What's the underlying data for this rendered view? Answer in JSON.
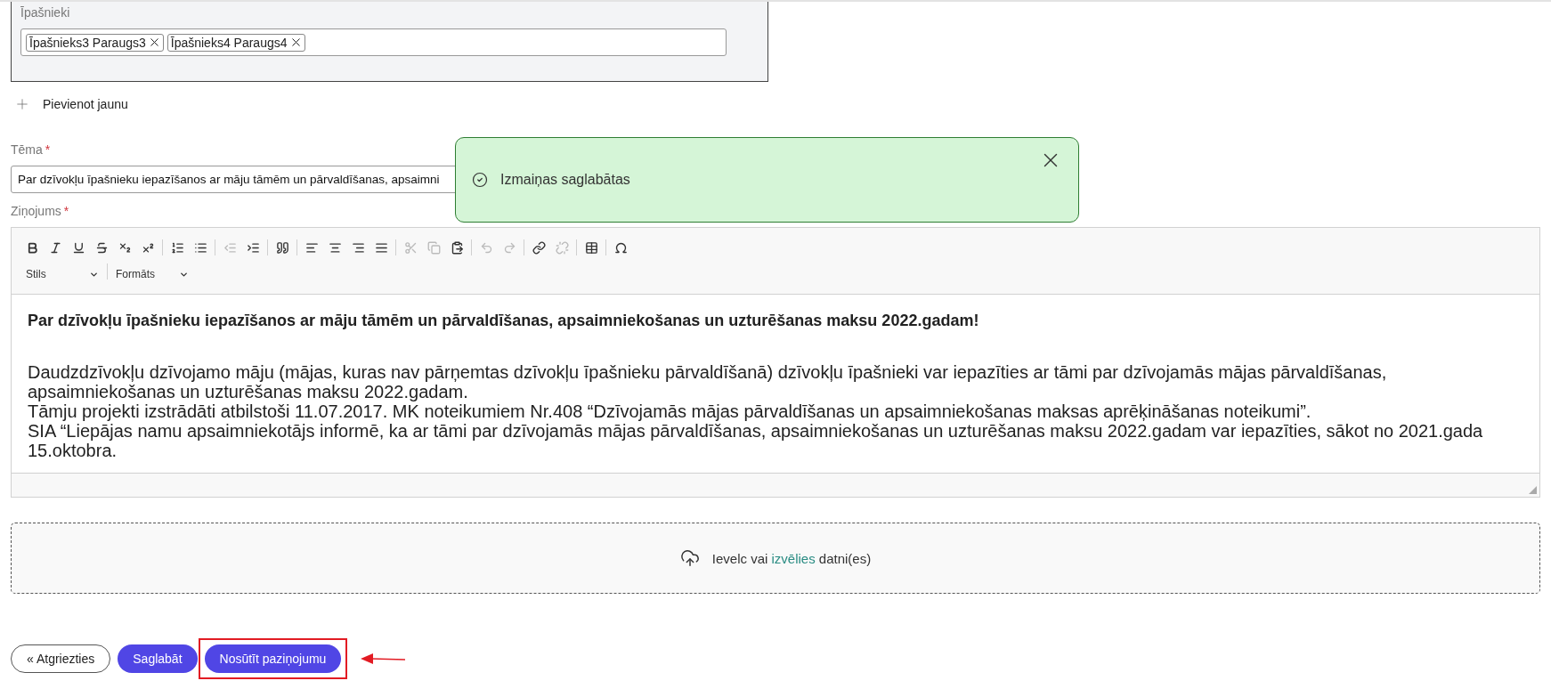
{
  "owners": {
    "label": "Īpašnieki",
    "tags": [
      {
        "text": "Īpašnieks3 Paraugs3"
      },
      {
        "text": "Īpašnieks4 Paraugs4"
      }
    ]
  },
  "add_new": {
    "label": "Pievienot jaunu"
  },
  "subject": {
    "label": "Tēma",
    "required_mark": "*",
    "value": "Par dzīvokļu īpašnieku iepazīšanos ar māju tāmēm un pārvaldīšanas, apsaimni"
  },
  "message": {
    "label": "Ziņojums",
    "required_mark": "*",
    "toolbar": [
      {
        "kind": "bold",
        "disabled": false
      },
      {
        "kind": "italic",
        "disabled": false
      },
      {
        "kind": "underline",
        "disabled": false
      },
      {
        "kind": "strike",
        "disabled": false
      },
      {
        "kind": "subscript",
        "disabled": false
      },
      {
        "kind": "superscript",
        "disabled": false
      },
      {
        "kind": "sep"
      },
      {
        "kind": "numbered-list",
        "disabled": false
      },
      {
        "kind": "bulleted-list",
        "disabled": false
      },
      {
        "kind": "sep"
      },
      {
        "kind": "outdent",
        "disabled": true
      },
      {
        "kind": "indent",
        "disabled": false
      },
      {
        "kind": "sep"
      },
      {
        "kind": "quote",
        "disabled": false
      },
      {
        "kind": "sep"
      },
      {
        "kind": "align-left",
        "disabled": false
      },
      {
        "kind": "align-center",
        "disabled": false
      },
      {
        "kind": "align-right",
        "disabled": false
      },
      {
        "kind": "align-justify",
        "disabled": false
      },
      {
        "kind": "sep"
      },
      {
        "kind": "cut",
        "disabled": true
      },
      {
        "kind": "copy",
        "disabled": true
      },
      {
        "kind": "paste",
        "disabled": false
      },
      {
        "kind": "sep"
      },
      {
        "kind": "undo",
        "disabled": true
      },
      {
        "kind": "redo",
        "disabled": true
      },
      {
        "kind": "sep"
      },
      {
        "kind": "link",
        "disabled": false
      },
      {
        "kind": "unlink",
        "disabled": true
      },
      {
        "kind": "sep"
      },
      {
        "kind": "table",
        "disabled": false
      },
      {
        "kind": "sep"
      },
      {
        "kind": "special-char",
        "disabled": false
      }
    ],
    "dropdowns": [
      {
        "label": "Stils"
      },
      {
        "label": "Formāts"
      }
    ],
    "heading": "Par dzīvokļu īpašnieku iepazīšanos ar māju tāmēm un pārvaldīšanas, apsaimniekošanas un uzturēšanas maksu 2022.gadam!",
    "paragraphs": [
      "Daudzdzīvokļu dzīvojamo māju (mājas, kuras nav pārņemtas dzīvokļu īpašnieku pārvaldīšanā) dzīvokļu īpašnieki var iepazīties ar tāmi par dzīvojamās mājas pārvaldīšanas, apsaimniekošanas un uzturēšanas maksu 2022.gadam.",
      "Tāmju projekti izstrādāti atbilstoši 11.07.2017. MK noteikumiem Nr.408 “Dzīvojamās mājas pārvaldīšanas un apsaimniekošanas maksas aprēķināšanas noteikumi”.",
      "SIA “Liepājas namu apsaimniekotājs informē, ka ar tāmi par dzīvojamās mājas pārvaldīšanas, apsaimniekošanas un uzturēšanas maksu 2022.gadam var iepazīties, sākot no 2021.gada 15.oktobra."
    ]
  },
  "dropzone": {
    "before": "Ievelc vai",
    "link": "izvēlies",
    "after": "datni(es)"
  },
  "buttons": [
    {
      "label": "« Atgriezties",
      "kind": "outline",
      "highlighted": false
    },
    {
      "label": "Saglabāt",
      "kind": "primary",
      "highlighted": false
    },
    {
      "label": "Nosūtīt paziņojumu",
      "kind": "primary",
      "highlighted": true
    }
  ],
  "toast": {
    "message": "Izmaiņas saglabātas"
  }
}
